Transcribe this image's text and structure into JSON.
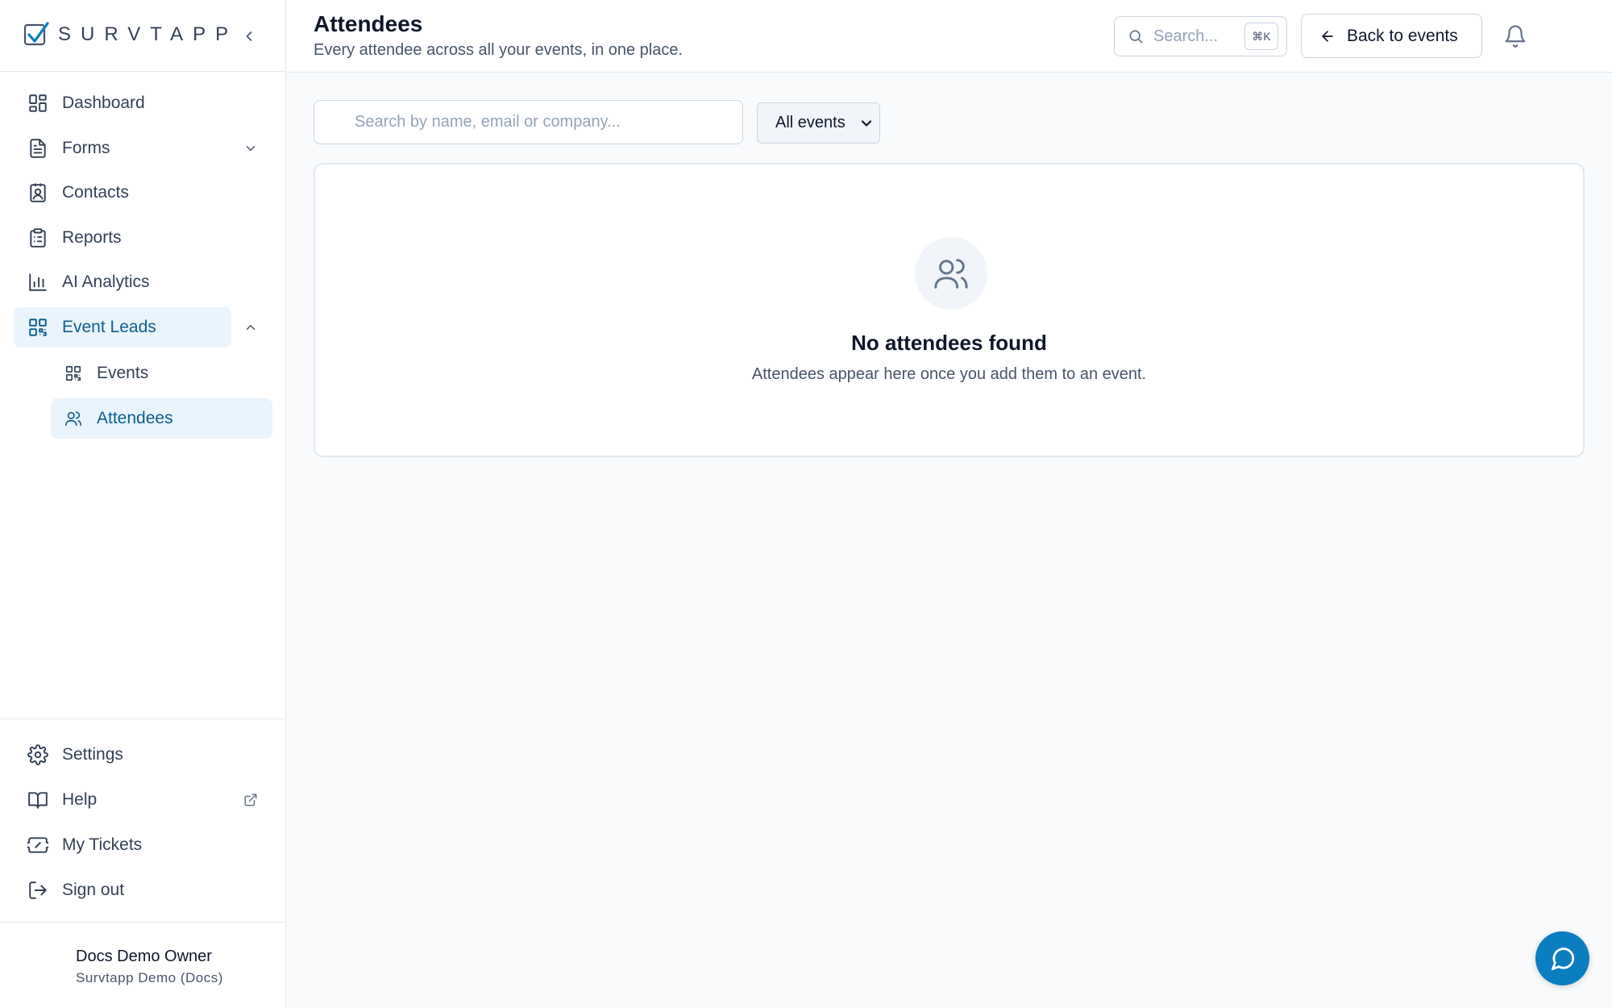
{
  "brand": {
    "name": "SURVTAPP",
    "accent": "#0b7ec2",
    "active_bg": "#eaf4fc",
    "active_text": "#0b5e8e"
  },
  "sidebar": {
    "collapse_icon": "chevron-left-icon",
    "items": [
      {
        "label": "Dashboard",
        "icon": "layout-dashboard-icon"
      },
      {
        "label": "Forms",
        "icon": "file-text-icon",
        "expandable": true,
        "expanded": false
      },
      {
        "label": "Contacts",
        "icon": "contact-icon"
      },
      {
        "label": "Reports",
        "icon": "clipboard-list-icon"
      },
      {
        "label": "AI Analytics",
        "icon": "bar-chart-icon"
      },
      {
        "label": "Event Leads",
        "icon": "qr-code-icon",
        "expandable": true,
        "expanded": true,
        "active": true
      }
    ],
    "sub_items": [
      {
        "label": "Events",
        "icon": "qr-code-icon",
        "active": false
      },
      {
        "label": "Attendees",
        "icon": "users-icon",
        "active": true
      }
    ],
    "bottom_items": [
      {
        "label": "Settings",
        "icon": "gear-icon"
      },
      {
        "label": "Help",
        "icon": "book-open-icon",
        "external": true
      },
      {
        "label": "My Tickets",
        "icon": "ticket-icon"
      },
      {
        "label": "Sign out",
        "icon": "log-out-icon"
      }
    ],
    "user": {
      "name": "Docs Demo Owner",
      "org": "Survtapp Demo (Docs)"
    }
  },
  "header": {
    "title": "Attendees",
    "subtitle": "Every attendee across all your events, in one place.",
    "search_placeholder": "Search...",
    "search_shortcut": "⌘K",
    "back_label": "Back to events",
    "bell_icon": "bell-icon"
  },
  "filters": {
    "search_placeholder": "Search by name, email or company...",
    "search_value": "",
    "event_filter_selected": "All events"
  },
  "empty_state": {
    "icon": "users-icon",
    "title": "No attendees found",
    "description": "Attendees appear here once you add them to an event."
  },
  "chat": {
    "icon": "message-circle-icon"
  }
}
